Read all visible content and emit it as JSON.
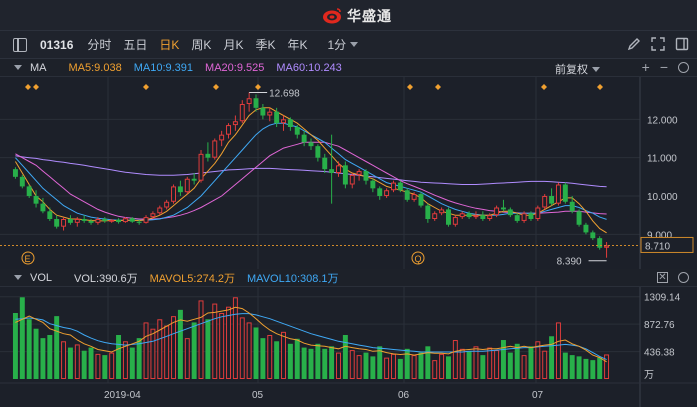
{
  "app": {
    "brand": "华盛通"
  },
  "toolbar": {
    "symbol": "01316",
    "periods": [
      "分时",
      "五日",
      "日K",
      "周K",
      "月K",
      "季K",
      "年K"
    ],
    "active_period": "日K",
    "interval": "1分"
  },
  "main_pane": {
    "name": "MA",
    "legend": [
      {
        "label": "MA5:9.038",
        "color": "#f0a030"
      },
      {
        "label": "MA10:9.391",
        "color": "#3fa9f5"
      },
      {
        "label": "MA20:9.525",
        "color": "#e066d6"
      },
      {
        "label": "MA60:10.243",
        "color": "#b08cff"
      }
    ],
    "adjust_label": "前复权",
    "y_ticks": [
      "12.000",
      "11.000",
      "10.000",
      "9.000"
    ],
    "high_label": "12.698",
    "low_label": "8.390",
    "last_price": "8.710",
    "event_markers": [
      "E",
      "Q"
    ]
  },
  "vol_pane": {
    "name": "VOL",
    "legend": [
      {
        "label": "VOL:390.6万",
        "color": "#d4d6dc"
      },
      {
        "label": "MAVOL5:274.2万",
        "color": "#f0a030"
      },
      {
        "label": "MAVOL10:308.1万",
        "color": "#3fa9f5"
      }
    ],
    "y_ticks": [
      "1309.14",
      "872.76",
      "436.38"
    ],
    "unit": "万"
  },
  "x_axis": {
    "labels": [
      "2019-04",
      "05",
      "06",
      "07"
    ]
  },
  "colors": {
    "up": "#e03c3c",
    "down": "#28b04a",
    "bg": "#1c2029"
  },
  "chart_data": {
    "type": "candlestick",
    "price_range": [
      8.2,
      13.0
    ],
    "candles": [
      [
        10.7,
        10.75,
        10.45,
        10.5
      ],
      [
        10.5,
        10.55,
        10.2,
        10.25
      ],
      [
        10.25,
        10.3,
        9.95,
        10.0
      ],
      [
        10.0,
        10.15,
        9.7,
        9.8
      ],
      [
        9.8,
        9.95,
        9.55,
        9.6
      ],
      [
        9.6,
        9.7,
        9.35,
        9.4
      ],
      [
        9.4,
        9.5,
        9.15,
        9.2
      ],
      [
        9.2,
        9.45,
        9.1,
        9.4
      ],
      [
        9.4,
        9.5,
        9.25,
        9.3
      ],
      [
        9.3,
        9.45,
        9.2,
        9.4
      ],
      [
        9.4,
        9.5,
        9.3,
        9.35
      ],
      [
        9.35,
        9.4,
        9.25,
        9.3
      ],
      [
        9.3,
        9.45,
        9.25,
        9.4
      ],
      [
        9.4,
        9.45,
        9.3,
        9.35
      ],
      [
        9.35,
        9.4,
        9.3,
        9.38
      ],
      [
        9.38,
        9.42,
        9.28,
        9.32
      ],
      [
        9.32,
        9.45,
        9.3,
        9.42
      ],
      [
        9.42,
        9.45,
        9.3,
        9.33
      ],
      [
        9.33,
        9.38,
        9.25,
        9.3
      ],
      [
        9.3,
        9.5,
        9.28,
        9.45
      ],
      [
        9.45,
        9.6,
        9.4,
        9.55
      ],
      [
        9.55,
        9.75,
        9.5,
        9.7
      ],
      [
        9.7,
        9.9,
        9.65,
        9.85
      ],
      [
        9.85,
        10.3,
        9.8,
        10.25
      ],
      [
        10.25,
        10.4,
        10.0,
        10.1
      ],
      [
        10.1,
        10.5,
        10.05,
        10.45
      ],
      [
        10.45,
        10.6,
        10.3,
        10.4
      ],
      [
        10.4,
        11.2,
        10.35,
        11.1
      ],
      [
        11.1,
        11.4,
        10.9,
        11.0
      ],
      [
        11.0,
        11.5,
        10.95,
        11.45
      ],
      [
        11.45,
        11.7,
        11.3,
        11.6
      ],
      [
        11.6,
        11.9,
        11.5,
        11.85
      ],
      [
        11.85,
        12.1,
        11.7,
        11.95
      ],
      [
        11.95,
        12.5,
        11.9,
        12.4
      ],
      [
        12.4,
        12.7,
        12.2,
        12.55
      ],
      [
        12.55,
        12.65,
        12.2,
        12.3
      ],
      [
        12.3,
        12.4,
        12.0,
        12.1
      ],
      [
        12.1,
        12.3,
        11.95,
        12.2
      ],
      [
        12.2,
        12.3,
        11.8,
        11.9
      ],
      [
        11.9,
        12.1,
        11.7,
        12.0
      ],
      [
        12.0,
        12.05,
        11.7,
        11.8
      ],
      [
        11.8,
        11.85,
        11.5,
        11.6
      ],
      [
        11.6,
        11.7,
        11.3,
        11.4
      ],
      [
        11.4,
        11.5,
        11.2,
        11.3
      ],
      [
        11.3,
        11.35,
        10.9,
        11.0
      ],
      [
        11.0,
        11.1,
        10.6,
        10.7
      ],
      [
        10.7,
        11.6,
        9.8,
        10.6
      ],
      [
        10.6,
        10.9,
        10.5,
        10.8
      ],
      [
        10.8,
        10.9,
        10.2,
        10.3
      ],
      [
        10.3,
        10.6,
        10.2,
        10.55
      ],
      [
        10.55,
        10.7,
        10.4,
        10.65
      ],
      [
        10.65,
        10.7,
        10.3,
        10.4
      ],
      [
        10.4,
        10.45,
        10.1,
        10.2
      ],
      [
        10.2,
        10.25,
        9.9,
        10.0
      ],
      [
        10.0,
        10.2,
        9.95,
        10.15
      ],
      [
        10.15,
        10.4,
        10.1,
        10.35
      ],
      [
        10.35,
        10.4,
        10.1,
        10.15
      ],
      [
        10.15,
        10.2,
        9.85,
        9.9
      ],
      [
        9.9,
        10.1,
        9.85,
        10.05
      ],
      [
        10.05,
        10.1,
        9.7,
        9.75
      ],
      [
        9.75,
        9.8,
        9.3,
        9.4
      ],
      [
        9.4,
        9.6,
        9.35,
        9.55
      ],
      [
        9.55,
        9.7,
        9.5,
        9.65
      ],
      [
        9.65,
        9.7,
        9.2,
        9.25
      ],
      [
        9.25,
        9.5,
        9.2,
        9.45
      ],
      [
        9.45,
        9.6,
        9.4,
        9.55
      ],
      [
        9.55,
        9.6,
        9.4,
        9.45
      ],
      [
        9.45,
        9.6,
        9.4,
        9.5
      ],
      [
        9.5,
        9.6,
        9.35,
        9.4
      ],
      [
        9.4,
        9.55,
        9.35,
        9.5
      ],
      [
        9.5,
        9.75,
        9.45,
        9.7
      ],
      [
        9.7,
        9.9,
        9.6,
        9.65
      ],
      [
        9.65,
        9.7,
        9.45,
        9.5
      ],
      [
        9.5,
        9.55,
        9.3,
        9.35
      ],
      [
        9.35,
        9.6,
        9.3,
        9.55
      ],
      [
        9.55,
        9.6,
        9.35,
        9.4
      ],
      [
        9.4,
        9.75,
        9.35,
        9.7
      ],
      [
        9.7,
        10.05,
        9.65,
        10.0
      ],
      [
        10.0,
        10.2,
        9.75,
        9.8
      ],
      [
        9.8,
        10.35,
        9.75,
        10.3
      ],
      [
        10.3,
        10.35,
        9.8,
        9.85
      ],
      [
        9.85,
        10.0,
        9.55,
        9.6
      ],
      [
        9.6,
        9.65,
        9.2,
        9.25
      ],
      [
        9.25,
        9.3,
        9.0,
        9.05
      ],
      [
        9.05,
        9.1,
        8.85,
        8.9
      ],
      [
        8.9,
        8.95,
        8.6,
        8.65
      ],
      [
        8.65,
        8.8,
        8.39,
        8.71
      ]
    ],
    "volumes": [
      1050,
      1300,
      950,
      800,
      650,
      700,
      1000,
      600,
      500,
      550,
      450,
      500,
      400,
      380,
      420,
      700,
      600,
      500,
      650,
      900,
      800,
      950,
      850,
      1000,
      1100,
      650,
      900,
      1250,
      950,
      1200,
      1050,
      1150,
      1300,
      980,
      900,
      820,
      650,
      700,
      600,
      750,
      560,
      640,
      500,
      480,
      560,
      480,
      520,
      420,
      700,
      460,
      380,
      420,
      360,
      520,
      340,
      400,
      320,
      480,
      380,
      420,
      520,
      300,
      400,
      360,
      620,
      480,
      440,
      520,
      380,
      500,
      460,
      620,
      420,
      560,
      380,
      520,
      600,
      450,
      680,
      900,
      420,
      380,
      360,
      320,
      300,
      340,
      390.6
    ],
    "ma5": [
      10.9,
      10.6,
      10.3,
      10.0,
      9.85,
      9.65,
      9.5,
      9.45,
      9.4,
      9.4,
      9.38,
      9.36,
      9.35,
      9.35,
      9.36,
      9.36,
      9.37,
      9.37,
      9.36,
      9.38,
      9.43,
      9.5,
      9.6,
      9.75,
      9.9,
      10.05,
      10.2,
      10.45,
      10.65,
      10.85,
      11.1,
      11.4,
      11.6,
      11.85,
      12.1,
      12.25,
      12.3,
      12.3,
      12.2,
      12.1,
      12.0,
      11.9,
      11.75,
      11.6,
      11.45,
      11.25,
      11.05,
      10.85,
      10.7,
      10.6,
      10.55,
      10.5,
      10.45,
      10.35,
      10.25,
      10.2,
      10.15,
      10.1,
      10.05,
      9.95,
      9.8,
      9.7,
      9.6,
      9.55,
      9.5,
      9.5,
      9.5,
      9.5,
      9.5,
      9.5,
      9.55,
      9.6,
      9.6,
      9.55,
      9.5,
      9.5,
      9.55,
      9.65,
      9.75,
      9.85,
      9.95,
      9.95,
      9.8,
      9.6,
      9.35,
      9.15,
      9.04
    ],
    "ma10": [
      11.0,
      10.8,
      10.6,
      10.4,
      10.2,
      10.05,
      9.9,
      9.75,
      9.65,
      9.55,
      9.5,
      9.45,
      9.42,
      9.4,
      9.38,
      9.37,
      9.37,
      9.37,
      9.37,
      9.37,
      9.38,
      9.4,
      9.45,
      9.5,
      9.6,
      9.7,
      9.85,
      10.0,
      10.2,
      10.4,
      10.6,
      10.8,
      11.0,
      11.2,
      11.4,
      11.6,
      11.75,
      11.85,
      11.9,
      11.9,
      11.85,
      11.8,
      11.7,
      11.6,
      11.5,
      11.4,
      11.25,
      11.1,
      10.95,
      10.85,
      10.75,
      10.65,
      10.55,
      10.45,
      10.35,
      10.3,
      10.25,
      10.2,
      10.15,
      10.1,
      10.0,
      9.9,
      9.8,
      9.72,
      9.65,
      9.6,
      9.55,
      9.52,
      9.5,
      9.5,
      9.5,
      9.52,
      9.55,
      9.55,
      9.55,
      9.55,
      9.55,
      9.6,
      9.65,
      9.7,
      9.75,
      9.75,
      9.7,
      9.62,
      9.55,
      9.45,
      9.39
    ],
    "ma20": [
      11.1,
      11.0,
      10.9,
      10.8,
      10.65,
      10.5,
      10.35,
      10.2,
      10.05,
      9.95,
      9.85,
      9.75,
      9.65,
      9.58,
      9.52,
      9.47,
      9.44,
      9.42,
      9.4,
      9.4,
      9.4,
      9.41,
      9.43,
      9.46,
      9.5,
      9.55,
      9.62,
      9.7,
      9.8,
      9.9,
      10.0,
      10.15,
      10.3,
      10.45,
      10.6,
      10.75,
      10.9,
      11.05,
      11.15,
      11.25,
      11.3,
      11.35,
      11.4,
      11.4,
      11.4,
      11.4,
      11.35,
      11.3,
      11.2,
      11.1,
      11.0,
      10.9,
      10.8,
      10.7,
      10.6,
      10.5,
      10.4,
      10.32,
      10.25,
      10.18,
      10.1,
      10.02,
      9.95,
      9.88,
      9.82,
      9.77,
      9.72,
      9.68,
      9.65,
      9.62,
      9.6,
      9.58,
      9.57,
      9.56,
      9.55,
      9.55,
      9.55,
      9.56,
      9.57,
      9.58,
      9.6,
      9.6,
      9.6,
      9.58,
      9.56,
      9.54,
      9.53
    ],
    "ma60": [
      11.05,
      11.02,
      11.0,
      10.98,
      10.95,
      10.93,
      10.9,
      10.88,
      10.85,
      10.83,
      10.8,
      10.77,
      10.74,
      10.71,
      10.68,
      10.65,
      10.62,
      10.6,
      10.58,
      10.56,
      10.55,
      10.54,
      10.54,
      10.54,
      10.55,
      10.56,
      10.58,
      10.6,
      10.62,
      10.64,
      10.66,
      10.68,
      10.69,
      10.7,
      10.71,
      10.72,
      10.72,
      10.72,
      10.71,
      10.7,
      10.69,
      10.68,
      10.67,
      10.66,
      10.65,
      10.64,
      10.62,
      10.6,
      10.58,
      10.56,
      10.54,
      10.52,
      10.5,
      10.48,
      10.46,
      10.44,
      10.42,
      10.4,
      10.38,
      10.36,
      10.35,
      10.34,
      10.33,
      10.32,
      10.31,
      10.3,
      10.3,
      10.3,
      10.31,
      10.32,
      10.33,
      10.34,
      10.35,
      10.36,
      10.37,
      10.38,
      10.38,
      10.38,
      10.37,
      10.36,
      10.35,
      10.33,
      10.31,
      10.29,
      10.27,
      10.25,
      10.24
    ],
    "mavol5": [
      900,
      950,
      1000,
      950,
      900,
      800,
      760,
      720,
      700,
      620,
      560,
      520,
      470,
      450,
      430,
      480,
      520,
      560,
      600,
      680,
      720,
      780,
      840,
      900,
      940,
      920,
      950,
      980,
      1050,
      1060,
      1080,
      1100,
      1140,
      1120,
      1050,
      960,
      860,
      780,
      720,
      680,
      640,
      620,
      570,
      540,
      530,
      520,
      500,
      480,
      520,
      500,
      480,
      470,
      440,
      450,
      420,
      400,
      390,
      400,
      380,
      400,
      420,
      410,
      410,
      400,
      440,
      460,
      470,
      480,
      470,
      480,
      480,
      500,
      520,
      500,
      520,
      500,
      520,
      540,
      550,
      600,
      620,
      560,
      520,
      460,
      380,
      340,
      274
    ],
    "mavol10": [
      950,
      960,
      970,
      960,
      940,
      880,
      850,
      820,
      800,
      760,
      700,
      650,
      610,
      580,
      560,
      550,
      540,
      550,
      560,
      580,
      600,
      640,
      680,
      720,
      760,
      800,
      840,
      880,
      920,
      960,
      990,
      1010,
      1030,
      1040,
      1040,
      1020,
      990,
      960,
      920,
      880,
      840,
      800,
      760,
      720,
      690,
      660,
      630,
      600,
      580,
      560,
      540,
      520,
      500,
      490,
      480,
      470,
      460,
      450,
      440,
      430,
      430,
      430,
      430,
      430,
      430,
      430,
      440,
      440,
      440,
      450,
      460,
      470,
      480,
      490,
      500,
      500,
      510,
      520,
      530,
      540,
      550,
      540,
      520,
      480,
      420,
      360,
      308
    ],
    "vol_max": 1400
  }
}
